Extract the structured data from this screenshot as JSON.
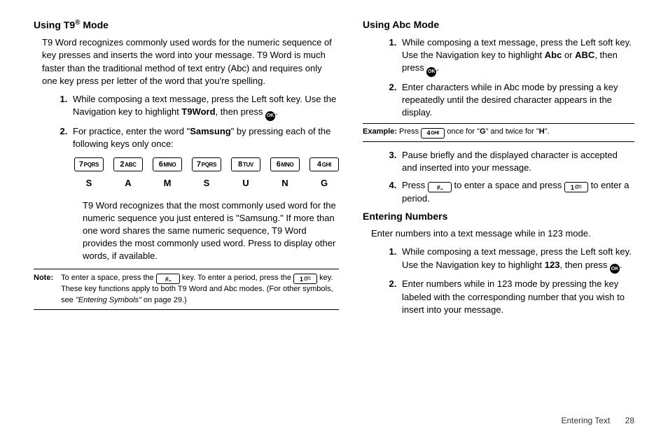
{
  "left": {
    "h1_a": "Using T9",
    "h1_b": " Mode",
    "sup": "®",
    "intro": "T9 Word recognizes commonly used words for the numeric sequence of key presses and inserts the word into your message. T9 Word is much faster than the traditional method of text entry (Abc) and requires only one key press per letter of the word that you're spelling.",
    "li1a": "While composing a text message, press the Left soft key. Use the Navigation key to highlight ",
    "li1b": "T9Word",
    "li1c": ", then press ",
    "li1d": ".",
    "li2a": "For practice, enter the word \"",
    "li2b": "Samsung",
    "li2c": "\" by pressing each of the following keys only once:",
    "keys": [
      {
        "d": "7",
        "t": "PQRS"
      },
      {
        "d": "2",
        "t": "ABC"
      },
      {
        "d": "6",
        "t": "MNO"
      },
      {
        "d": "7",
        "t": "PQRS"
      },
      {
        "d": "8",
        "t": "TUV"
      },
      {
        "d": "6",
        "t": "MNO"
      },
      {
        "d": "4",
        "t": "GHI"
      }
    ],
    "letters": [
      "S",
      "A",
      "M",
      "S",
      "U",
      "N",
      "G"
    ],
    "para2": "T9 Word recognizes that the most commonly used word for the numeric sequence you just entered is \"Samsung.\" If more than one word shares the same numeric sequence, T9 Word provides the most commonly used word. Press  to display other words, if available.",
    "note_label": "Note:",
    "note_a": "To enter a space, press the ",
    "note_b": " key. To enter a period, press the ",
    "note_c": " key. These key functions apply to both T9 Word and Abc modes. (For other symbols, see ",
    "note_ital": "\"Entering Symbols\"",
    "note_d": " on page 29.)",
    "hashkey": {
      "d": "#",
      "t": "⎵"
    },
    "onekey": {
      "d": "1",
      "t": "@!:"
    }
  },
  "right": {
    "h1": "Using Abc Mode",
    "li1a": "While composing a text message, press the Left soft key. Use the Navigation key to highlight ",
    "li1b": "Abc",
    "li1c": " or ",
    "li1d": "ABC",
    "li1e": ", then press ",
    "li1f": ".",
    "li2": "Enter characters while in Abc mode by pressing a key repeatedly until the desired character appears in the display.",
    "ex_label": "Example:",
    "ex_a": "Press ",
    "ex_b": " once for \"",
    "ex_c": "G",
    "ex_d": "\" and twice for \"",
    "ex_e": "H",
    "ex_f": "\".",
    "ex_key": {
      "d": "4",
      "t": "GHI"
    },
    "li3": "Pause briefly and the displayed character is accepted and inserted into your message.",
    "li4a": "Press ",
    "li4b": " to enter a space and press ",
    "li4c": " to enter a period.",
    "h2": "Entering Numbers",
    "intro2": "Enter numbers into a text message while in 123 mode.",
    "n_li1a": "While composing a text message, press the Left soft key. Use the Navigation key to highlight ",
    "n_li1b": "123",
    "n_li1c": ", then press ",
    "n_li1d": ".",
    "n_li2": "Enter numbers while in 123 mode by pressing the key labeled with the corresponding number that you wish to insert into your message."
  },
  "footer": {
    "section": "Entering Text",
    "page": "28"
  },
  "ok_label": "OK"
}
